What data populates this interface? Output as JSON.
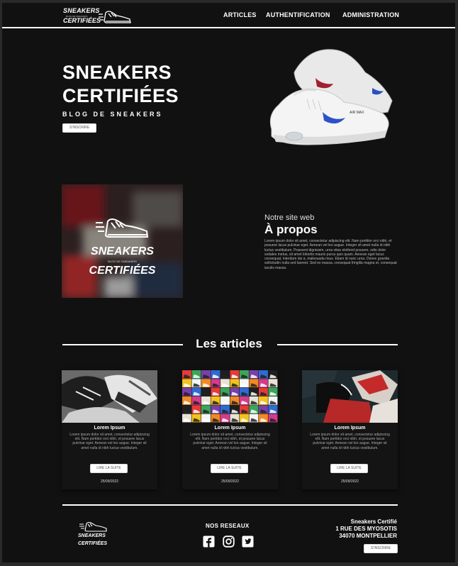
{
  "header": {
    "logo": {
      "line1": "SNEAKERS",
      "tagline": "BLOG DE SNEAKERS",
      "line2": "CERTIFIÉES"
    },
    "nav": [
      "ARTICLES",
      "AUTHENTIFICATION",
      "ADMINISTRATION"
    ]
  },
  "hero": {
    "title_line1": "SNEAKERS",
    "title_line2": "CERTIFIÉES",
    "subtitle": "BLOG DE SNEAKERS",
    "button": "S'INSCRIRE"
  },
  "about": {
    "image_logo": {
      "line1": "SNEAKERS",
      "tagline": "BLOG DE SNEAKERS",
      "line2": "CERTIFIÉES"
    },
    "kicker": "Notre site web",
    "title": "À propos",
    "text": "Lorem ipsum dolor sit amet, consectetur adipiscing elit. Nam porttitor orci nibh, et posuere lacus pulvinar eget. Aenean vel leo augue. Integer sit amet nulla id nibh luctus vestibulum. Praesent dignissim, urna vitae eleifend posuere, odio dolor sodales metus, sit amet lobortis mauris purus quis quam. Aenean eget lacus consequat, interdum dui a, malesuada risus. Etiam id nunc urna. Donec gravida sollicitudin nulla sed laoreet. Sed ex massa, consequat fringilla magna et, consequat iaculis massa."
  },
  "articles": {
    "section_title": "Les articles",
    "cards": [
      {
        "title": "Lorem Ipsum",
        "text": "Lorem ipsum dolor sit amet, consectetur adipiscing elit. Nam porttitor orci nibh, et posuere lacus pulvinar eget. Aenean vel leo augue. Integer sit amet nulla id nibh luctus vestibulum.",
        "button": "LIRE LA SUITE",
        "date": "25/09/2022"
      },
      {
        "title": "Lorem Ipsum",
        "text": "Lorem ipsum dolor sit amet, consectetur adipiscing elit. Nam porttitor orci nibh, et posuere lacus pulvinar eget. Aenean vel leo augue. Integer sit amet nulla id nibh luctus vestibulum.",
        "button": "LIRE LA SUITE",
        "date": "25/09/2022"
      },
      {
        "title": "Lorem Ipsum",
        "text": "Lorem ipsum dolor sit amet, consectetur adipiscing elit. Nam porttitor orci nibh, et posuere lacus pulvinar eget. Aenean vel leo augue. Integer sit amet nulla id nibh luctus vestibulum.",
        "button": "LIRE LA SUITE",
        "date": "25/09/2022"
      }
    ]
  },
  "footer": {
    "logo": {
      "line1": "SNEAKERS",
      "line2": "CERTIFIÉES"
    },
    "social_title": "NOS RESEAUX",
    "social_icons": [
      "facebook-icon",
      "instagram-icon",
      "twitter-icon"
    ],
    "address": {
      "name": "Sneakers Certifié",
      "street": "1 RUE DES MYOSOTIS",
      "city": "34070 MONTPELLIER"
    },
    "button": "S'INSCRIRE"
  },
  "colors": {
    "background": "#111111",
    "text": "#ffffff",
    "button_bg": "#ffffff"
  }
}
